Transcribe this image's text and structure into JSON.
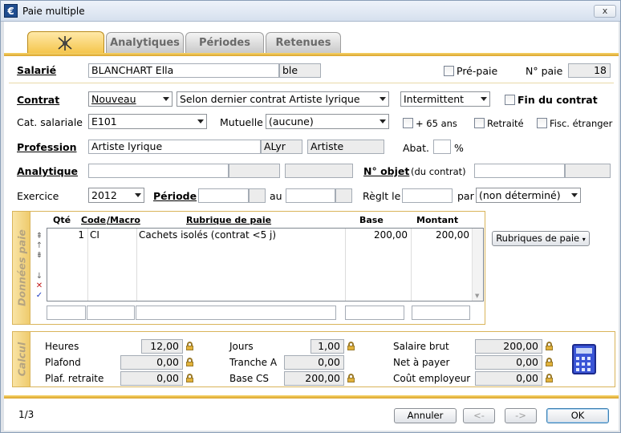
{
  "window": {
    "title": "Paie multiple",
    "close_label": "x"
  },
  "tabs": [
    {
      "label": ""
    },
    {
      "label": "Analytiques"
    },
    {
      "label": "Périodes"
    },
    {
      "label": "Retenues"
    }
  ],
  "salarie": {
    "label": "Salarié",
    "name": "BLANCHART Ella",
    "code": "ble",
    "prepaie_label": "Pré-paie",
    "npaie_label": "N° paie",
    "npaie_value": "18"
  },
  "contrat": {
    "label": "Contrat",
    "type": "Nouveau",
    "mode": "Selon dernier contrat Artiste lyrique",
    "status": "Intermittent",
    "fin_label": "Fin du contrat",
    "cat_label": "Cat. salariale",
    "cat_value": "E101",
    "mutuelle_label": "Mutuelle",
    "mutuelle_value": "(aucune)",
    "plus65_label": "+ 65 ans",
    "retraite_label": "Retraité",
    "fisc_label": "Fisc. étranger"
  },
  "profession": {
    "label": "Profession",
    "value": "Artiste lyrique",
    "code": "ALyr",
    "short": "Artiste",
    "abat_label": "Abat.",
    "abat_unit": "%"
  },
  "analytique": {
    "label": "Analytique",
    "nobjet_label": "N° objet",
    "nobjet_hint": "(du contrat)"
  },
  "periode": {
    "exercice_label": "Exercice",
    "exercice_value": "2012",
    "periode_label": "Période",
    "au_label": "au",
    "reglt_label": "Règlt le",
    "par_label": "par",
    "par_value": "(non déterminé)"
  },
  "donnees": {
    "side_label": "Données paie",
    "headers": {
      "qte": "Qté",
      "code": "Code",
      "macro": "/Macro",
      "rubrique": "Rubrique de paie",
      "base": "Base",
      "montant": "Montant"
    },
    "rows": [
      {
        "qte": "1",
        "code": "CI",
        "rubrique": "Cachets isolés (contrat <5 j)",
        "base": "200,00",
        "montant": "200,00"
      }
    ],
    "rubriques_button": "Rubriques de paie"
  },
  "calcul": {
    "side_label": "Calcul",
    "heures_label": "Heures",
    "heures": "12,00",
    "plafond_label": "Plafond",
    "plafond": "0,00",
    "plafret_label": "Plaf. retraite",
    "plafret": "0,00",
    "jours_label": "Jours",
    "jours": "1,00",
    "trancheA_label": "Tranche A",
    "trancheA": "0,00",
    "baseCS_label": "Base CS",
    "baseCS": "200,00",
    "brut_label": "Salaire brut",
    "brut": "200,00",
    "net_label": "Net à payer",
    "net": "0,00",
    "cout_label": "Coût employeur",
    "cout": "0,00"
  },
  "footer": {
    "page": "1/3",
    "annuler": "Annuler",
    "prev": "<-",
    "next": "->",
    "ok": "OK"
  }
}
